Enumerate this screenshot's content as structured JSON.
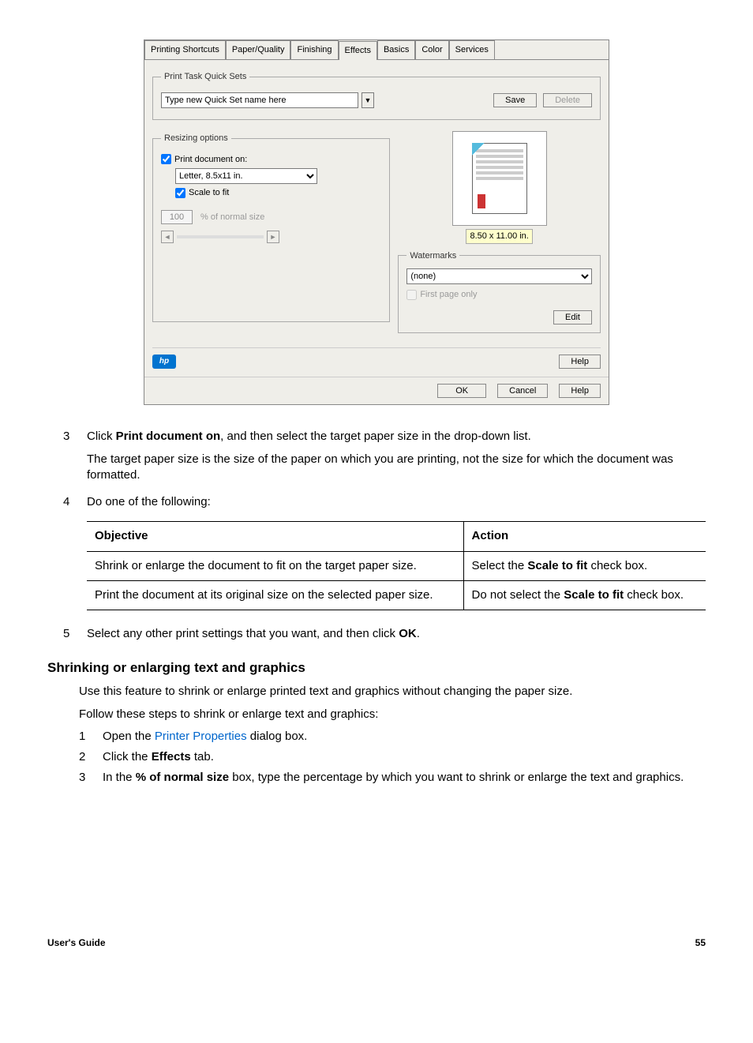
{
  "dialog": {
    "tabs": [
      "Printing Shortcuts",
      "Paper/Quality",
      "Finishing",
      "Effects",
      "Basics",
      "Color",
      "Services"
    ],
    "active_tab": "Effects",
    "quicksets": {
      "legend": "Print Task Quick Sets",
      "placeholder": "Type new Quick Set name here",
      "save": "Save",
      "delete": "Delete"
    },
    "resizing": {
      "legend": "Resizing options",
      "print_doc_on": "Print document on:",
      "paper_value": "Letter, 8.5x11 in.",
      "scale_to_fit": "Scale to fit",
      "percent_value": "100",
      "percent_label": "% of normal size"
    },
    "preview_dim": "8.50 x 11.00 in.",
    "watermarks": {
      "legend": "Watermarks",
      "value": "(none)",
      "first_page": "First page only",
      "edit": "Edit"
    },
    "help": "Help",
    "ok": "OK",
    "cancel": "Cancel",
    "help2": "Help",
    "hp": "hp"
  },
  "step3_num": "3",
  "step3_a": "Click ",
  "step3_b": "Print document on",
  "step3_c": ", and then select the target paper size in the drop-down list.",
  "step3_para": "The target paper size is the size of the paper on which you are printing, not the size for which the document was formatted.",
  "step4_num": "4",
  "step4_text": "Do one of the following:",
  "table": {
    "h1": "Objective",
    "h2": "Action",
    "r1c1": "Shrink or enlarge the document to fit on the target paper size.",
    "r1c2a": "Select the ",
    "r1c2b": "Scale to fit",
    "r1c2c": " check box.",
    "r2c1": "Print the document at its original size on the selected paper size.",
    "r2c2a": "Do not select the ",
    "r2c2b": "Scale to fit",
    "r2c2c": " check box."
  },
  "step5_num": "5",
  "step5_a": "Select any other print settings that you want, and then click ",
  "step5_b": "OK",
  "step5_c": ".",
  "heading": "Shrinking or enlarging text and graphics",
  "para1": "Use this feature to shrink or enlarge printed text and graphics without changing the paper size.",
  "para2": "Follow these steps to shrink or enlarge text and graphics:",
  "s1_num": "1",
  "s1_a": "Open the ",
  "s1_link": "Printer Properties",
  "s1_b": " dialog box.",
  "s2_num": "2",
  "s2_a": "Click the ",
  "s2_b": "Effects",
  "s2_c": " tab.",
  "s3_num": "3",
  "s3_a": "In the ",
  "s3_b": "% of normal size",
  "s3_c": " box, type the percentage by which you want to shrink or enlarge the text and graphics.",
  "footer_left": "User's Guide",
  "footer_right": "55"
}
